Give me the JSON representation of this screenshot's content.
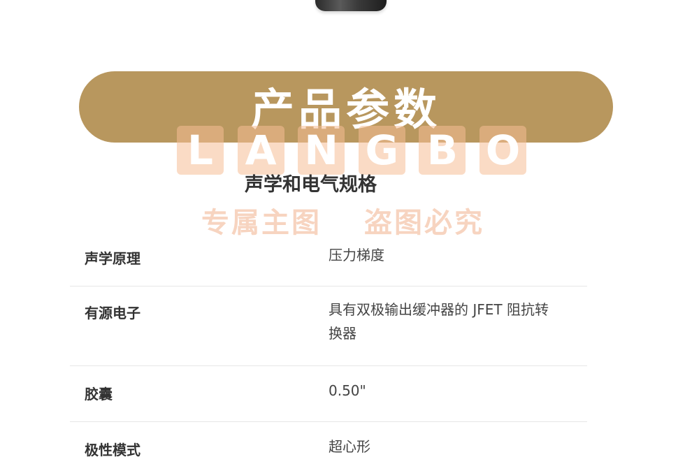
{
  "banner": {
    "title": "产品参数"
  },
  "watermark": {
    "logo_letters": [
      "L",
      "A",
      "N",
      "G",
      "B",
      "O"
    ],
    "text_left": "专属主图",
    "text_right": "盗图必究"
  },
  "section": {
    "title": "声学和电气规格"
  },
  "specs": [
    {
      "label": "声学原理",
      "value": "压力梯度"
    },
    {
      "label": "有源电子",
      "value": "具有双极输出缓冲器的 JFET 阻抗转换器"
    },
    {
      "label": "胶囊",
      "value": "0.50\""
    },
    {
      "label": "极性模式",
      "value": "超心形"
    }
  ]
}
